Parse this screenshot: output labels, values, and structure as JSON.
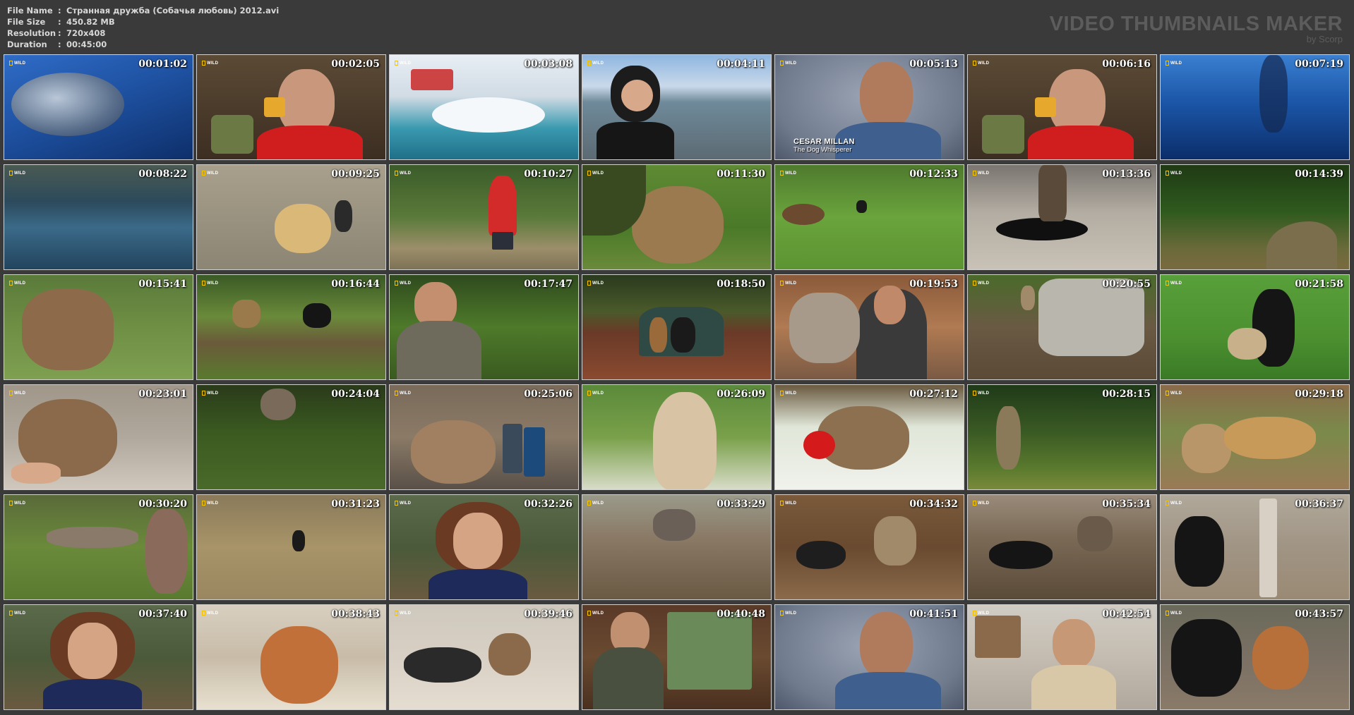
{
  "file_info": {
    "rows": [
      {
        "key": "File Name",
        "sep": ":",
        "value": "Странная дружба (Собачья любовь) 2012.avi"
      },
      {
        "key": "File Size",
        "sep": ":",
        "value": "450.82 MB"
      },
      {
        "key": "Resolution",
        "sep": ":",
        "value": "720x408"
      },
      {
        "key": "Duration",
        "sep": ":",
        "value": "00:45:00"
      }
    ]
  },
  "brand": {
    "title": "VIDEO THUMBNAILS MAKER",
    "subtitle": "by Scorp"
  },
  "channel_logo_text": "WILD",
  "thumbnails": [
    {
      "time": "00:01:02",
      "scene": "whale",
      "logo": true
    },
    {
      "time": "00:02:05",
      "scene": "man-red-interview",
      "logo": true
    },
    {
      "time": "00:03:08",
      "scene": "waves-splash",
      "logo": true
    },
    {
      "time": "00:04:11",
      "scene": "diver-pier",
      "logo": true
    },
    {
      "time": "00:05:13",
      "scene": "cesar-interview",
      "logo": true,
      "caption": {
        "name": "CESAR MILLAN",
        "sub": "The Dog Whisperer"
      }
    },
    {
      "time": "00:06:16",
      "scene": "man-red-interview",
      "logo": true
    },
    {
      "time": "00:07:19",
      "scene": "deep-blue",
      "logo": true
    },
    {
      "time": "00:08:22",
      "scene": "dark-water",
      "logo": true
    },
    {
      "time": "00:09:25",
      "scene": "dog-on-road",
      "logo": true
    },
    {
      "time": "00:10:27",
      "scene": "photographer-field",
      "logo": true
    },
    {
      "time": "00:11:30",
      "scene": "deer-closeup",
      "logo": true
    },
    {
      "time": "00:12:33",
      "scene": "dog-in-meadow",
      "logo": true
    },
    {
      "time": "00:13:36",
      "scene": "dog-lying-street",
      "logo": true
    },
    {
      "time": "00:14:39",
      "scene": "forest-path",
      "logo": true
    },
    {
      "time": "00:15:41",
      "scene": "deer-standing",
      "logo": true
    },
    {
      "time": "00:16:44",
      "scene": "deer-and-dog-lawn",
      "logo": true
    },
    {
      "time": "00:17:47",
      "scene": "woman-garden",
      "logo": true
    },
    {
      "time": "00:18:50",
      "scene": "dogs-on-porch",
      "logo": true
    },
    {
      "time": "00:19:53",
      "scene": "man-with-cows",
      "logo": true
    },
    {
      "time": "00:20:55",
      "scene": "stone-wall-rabbit",
      "logo": true
    },
    {
      "time": "00:21:58",
      "scene": "dog-green-lawn",
      "logo": true
    },
    {
      "time": "00:23:01",
      "scene": "bear-cub-hands",
      "logo": true
    },
    {
      "time": "00:24:04",
      "scene": "bear-in-forest",
      "logo": true
    },
    {
      "time": "00:25:06",
      "scene": "bear-cub-boots",
      "logo": true
    },
    {
      "time": "00:26:09",
      "scene": "bear-flowers",
      "logo": true
    },
    {
      "time": "00:27:12",
      "scene": "cheetah-cub-bed",
      "logo": true
    },
    {
      "time": "00:28:15",
      "scene": "dog-jumping-trees",
      "logo": true
    },
    {
      "time": "00:29:18",
      "scene": "cheetah-and-dog",
      "logo": true
    },
    {
      "time": "00:30:20",
      "scene": "log-in-grass",
      "logo": true
    },
    {
      "time": "00:31:23",
      "scene": "dog-dry-grass",
      "logo": true
    },
    {
      "time": "00:32:26",
      "scene": "woman-glasses-interview",
      "logo": true
    },
    {
      "time": "00:33:29",
      "scene": "donkey-corral",
      "logo": true
    },
    {
      "time": "00:34:32",
      "scene": "dog-deck-donkey",
      "logo": true
    },
    {
      "time": "00:35:34",
      "scene": "dog-fence-corral",
      "logo": true
    },
    {
      "time": "00:36:37",
      "scene": "dog-by-fence",
      "logo": true
    },
    {
      "time": "00:37:40",
      "scene": "woman-glasses-interview",
      "logo": true
    },
    {
      "time": "00:38:43",
      "scene": "fox-in-blanket",
      "logo": true
    },
    {
      "time": "00:39:46",
      "scene": "dog-and-fox-bed",
      "logo": true
    },
    {
      "time": "00:40:48",
      "scene": "bald-man-doorway",
      "logo": true
    },
    {
      "time": "00:41:51",
      "scene": "cesar-interview",
      "logo": true
    },
    {
      "time": "00:42:54",
      "scene": "bald-man-shelves",
      "logo": true
    },
    {
      "time": "00:43:57",
      "scene": "dog-and-fox-play",
      "logo": true
    }
  ]
}
